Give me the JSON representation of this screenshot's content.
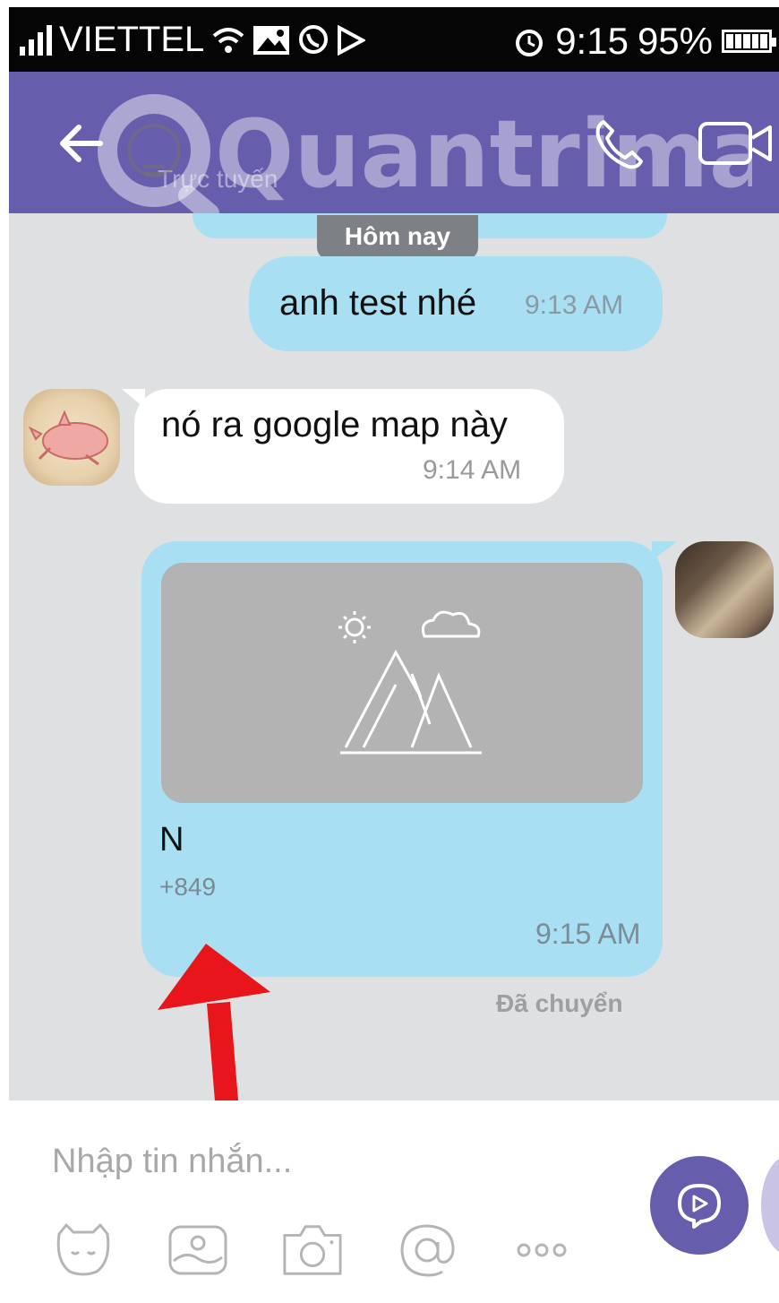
{
  "status_bar": {
    "carrier": "VIETTEL",
    "time": "9:15",
    "battery": "95%",
    "icons": [
      "signal-icon",
      "wifi-icon",
      "gallery-icon",
      "viber-icon",
      "play-icon",
      "alarm-icon",
      "battery-icon"
    ]
  },
  "header": {
    "subtitle": "Trực tuyến",
    "watermark": "Quantrimang",
    "icons": [
      "back-arrow-icon",
      "call-icon",
      "video-call-icon"
    ]
  },
  "chat": {
    "date_divider": "Hôm nay",
    "messages": [
      {
        "direction": "outgoing",
        "text": "anh test nhé",
        "time": "9:13 AM"
      },
      {
        "direction": "incoming",
        "text": "nó ra google map này",
        "time": "9:14 AM"
      },
      {
        "direction": "outgoing",
        "type": "contact",
        "name": "N",
        "phone": "+849",
        "time": "9:15 AM",
        "status": "Đã chuyển"
      }
    ]
  },
  "composer": {
    "placeholder": "Nhập tin nhắn...",
    "tools": [
      "sticker-icon",
      "gallery-icon",
      "camera-icon",
      "mention-icon",
      "more-icon"
    ],
    "more_label": "ooo"
  },
  "colors": {
    "header": "#665ead",
    "outgoing_bubble": "#a9dff2",
    "incoming_bubble": "#ffffff",
    "chat_background": "#dfe0e1",
    "annotation_arrow": "#e8151b"
  }
}
